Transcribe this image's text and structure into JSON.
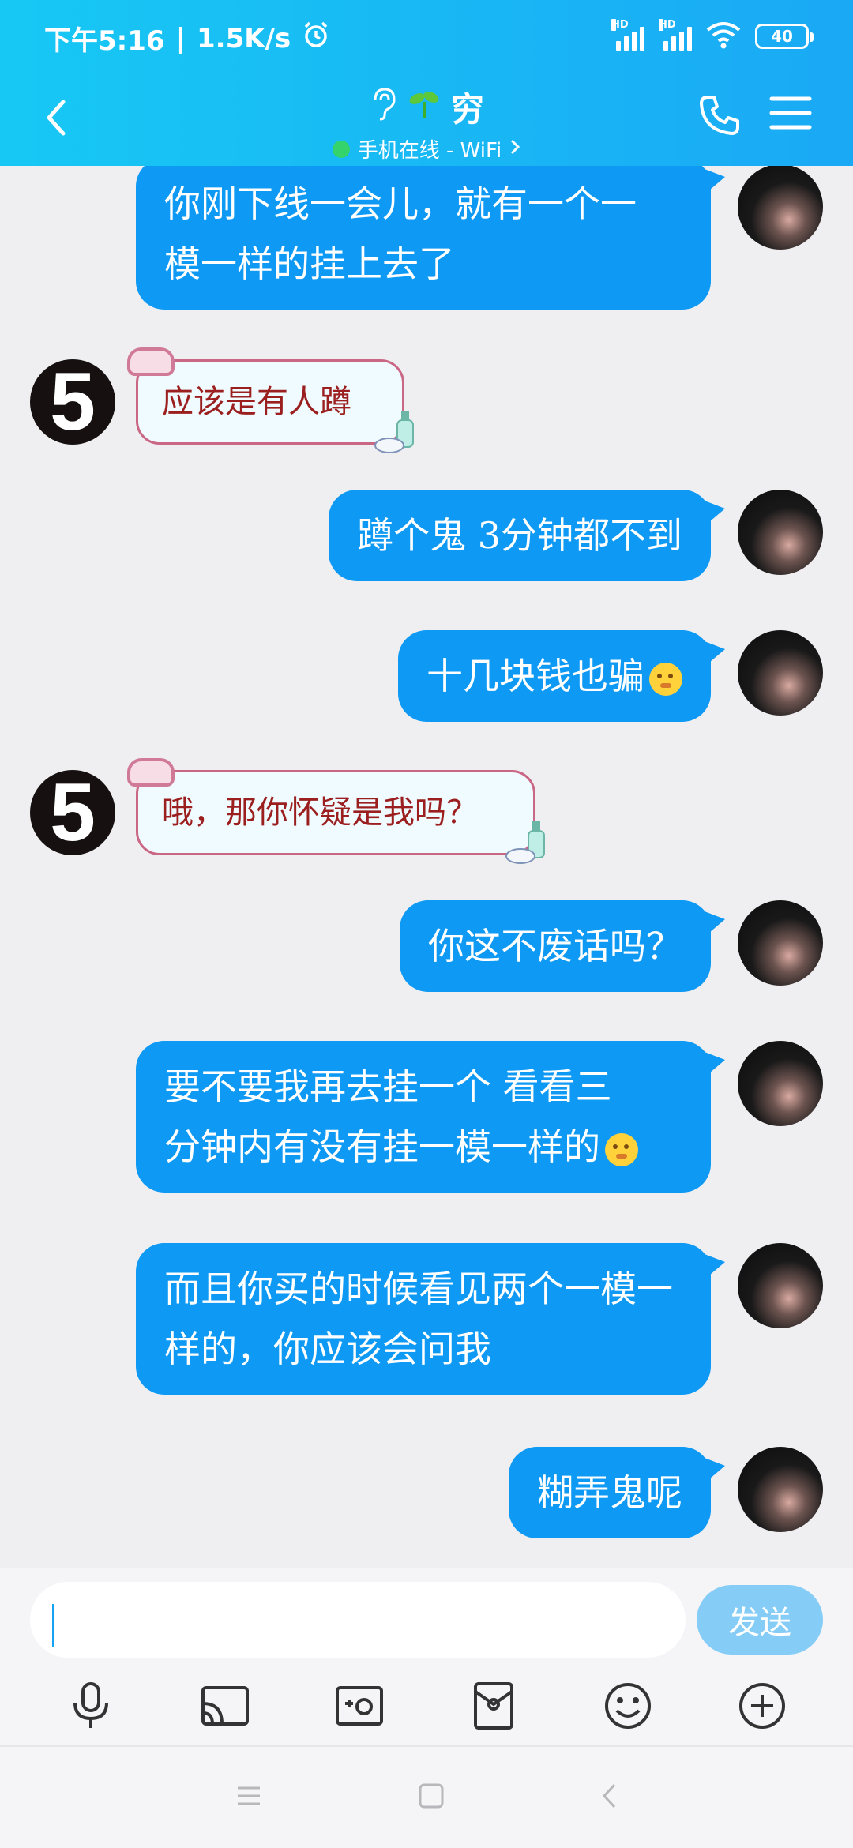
{
  "status_bar": {
    "time": "下午5:16",
    "network_speed": "1.5K/s",
    "signal1_badge": "HD",
    "signal2_badge": "HD",
    "battery": "40",
    "separator": "|"
  },
  "header": {
    "contact_name": "穷",
    "online_status": "手机在线 - WiFi",
    "online_color": "#34d36b"
  },
  "messages": [
    {
      "sender": "me",
      "lines": [
        "你刚下线一会儿，就有一个一",
        "模一样的挂上去了"
      ]
    },
    {
      "sender": "peer",
      "text": "应该是有人蹲",
      "avatar_text": "5"
    },
    {
      "sender": "me",
      "lines": [
        "蹲个鬼 3分钟都不到"
      ]
    },
    {
      "sender": "me",
      "lines": [
        "十几块钱也骗"
      ],
      "emoji": true
    },
    {
      "sender": "peer",
      "text": "哦，那你怀疑是我吗？",
      "avatar_text": "5"
    },
    {
      "sender": "me",
      "lines": [
        "你这不废话吗？"
      ]
    },
    {
      "sender": "me",
      "lines": [
        "要不要我再去挂一个 看看三",
        "分钟内有没有挂一模一样的"
      ],
      "emoji": true
    },
    {
      "sender": "me",
      "lines": [
        "而且你买的时候看见两个一模一",
        "样的，你应该会问我"
      ]
    },
    {
      "sender": "me",
      "lines": [
        "糊弄鬼呢"
      ]
    }
  ],
  "input": {
    "value": "",
    "send_label": "发送"
  },
  "colors": {
    "header": "#17c8f4",
    "my_bubble": "#0d99f4",
    "peer_text": "#9b1f1f",
    "send_button": "#85cdf7"
  }
}
